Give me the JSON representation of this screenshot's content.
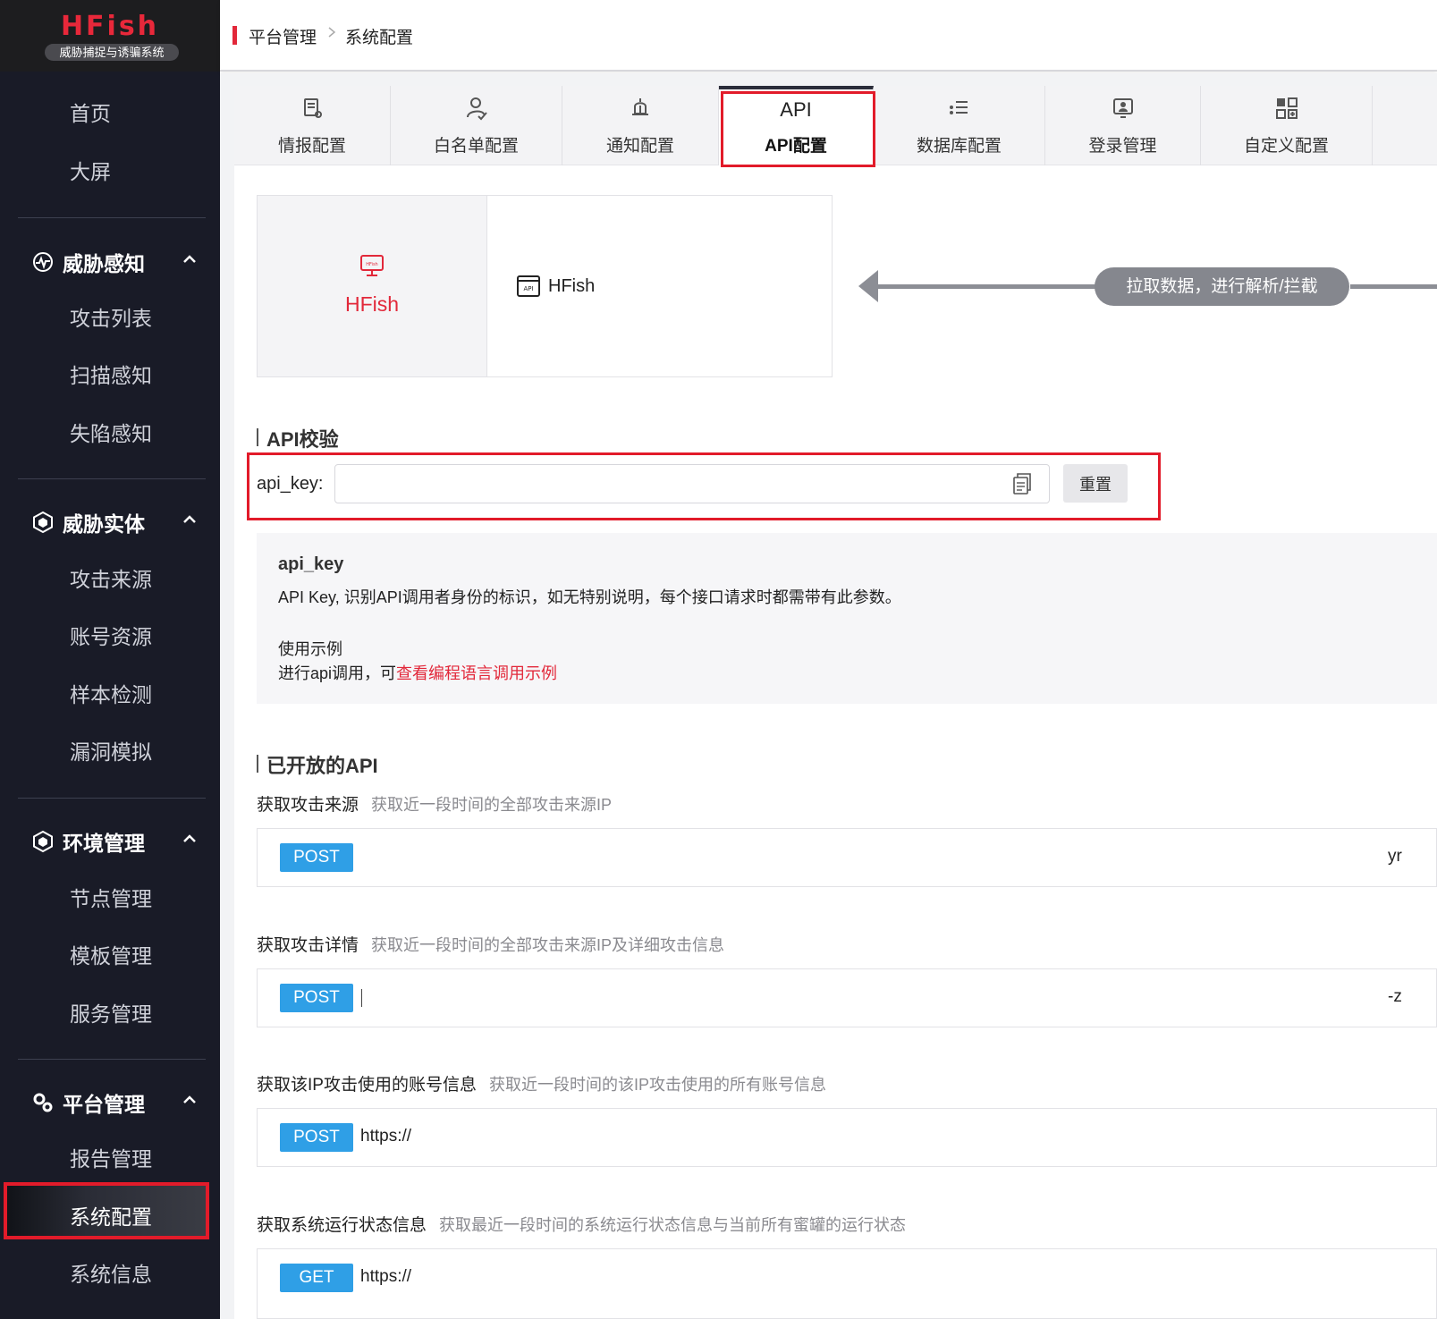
{
  "brand": {
    "title": "HFish",
    "subtitle": "威胁捕捉与诱骗系统"
  },
  "sidebar": {
    "top_items": [
      {
        "label": "首页"
      },
      {
        "label": "大屏"
      }
    ],
    "groups": [
      {
        "label": "威胁感知",
        "icon": "threat-perception-icon",
        "items": [
          "攻击列表",
          "扫描感知",
          "失陷感知"
        ]
      },
      {
        "label": "威胁实体",
        "icon": "threat-entity-icon",
        "items": [
          "攻击来源",
          "账号资源",
          "样本检测",
          "漏洞模拟"
        ]
      },
      {
        "label": "环境管理",
        "icon": "environment-icon",
        "items": [
          "节点管理",
          "模板管理",
          "服务管理"
        ]
      },
      {
        "label": "平台管理",
        "icon": "gears-icon",
        "items": [
          "报告管理",
          "系统配置",
          "系统信息"
        ]
      }
    ],
    "active": "系统配置"
  },
  "breadcrumb": {
    "parent": "平台管理",
    "current": "系统配置"
  },
  "tabs": [
    {
      "label": "情报配置",
      "icon": "intel-doc-icon"
    },
    {
      "label": "白名单配置",
      "icon": "user-check-icon"
    },
    {
      "label": "通知配置",
      "icon": "bell-icon"
    },
    {
      "label": "API配置",
      "top_text": "API",
      "active": true
    },
    {
      "label": "数据库配置",
      "icon": "database-list-icon"
    },
    {
      "label": "登录管理",
      "icon": "login-user-icon"
    },
    {
      "label": "自定义配置",
      "icon": "custom-grid-icon"
    }
  ],
  "flow": {
    "left_name": "HFish",
    "left_icon_text": "HFish",
    "right_icon_text": "API",
    "right_name": "HFish",
    "pill": "拉取数据，进行解析/拦截"
  },
  "api_check": {
    "title": "API校验",
    "key_label": "api_key:",
    "key_value": "",
    "reset_label": "重置"
  },
  "info": {
    "key_name": "api_key",
    "desc": "API Key, 识别API调用者身份的标识，如无特别说明，每个接口请求时都需带有此参数。",
    "example_title": "使用示例",
    "call_prefix": "进行api调用，可",
    "call_link": "查看编程语言调用示例"
  },
  "open_api": {
    "title": "已开放的API",
    "items": [
      {
        "name": "获取攻击来源",
        "desc": "获取近一段时间的全部攻击来源IP",
        "method": "POST",
        "url": "",
        "trail": "yr"
      },
      {
        "name": "获取攻击详情",
        "desc": "获取近一段时间的全部攻击来源IP及详细攻击信息",
        "method": "POST",
        "url": "",
        "trail": "-z"
      },
      {
        "name": "获取该IP攻击使用的账号信息",
        "desc": "获取近一段时间的该IP攻击使用的所有账号信息",
        "method": "POST",
        "url": "https://",
        "trail": ""
      },
      {
        "name": "获取系统运行状态信息",
        "desc": "获取最近一段时间的系统运行状态信息与当前所有蜜罐的运行状态",
        "method": "GET",
        "url": "https://",
        "trail": ""
      }
    ]
  },
  "colors": {
    "brand_red": "#e2283a",
    "sidebar_bg": "#191b27",
    "post_blue": "#2f9fe6",
    "highlight": "#e21b2a"
  }
}
